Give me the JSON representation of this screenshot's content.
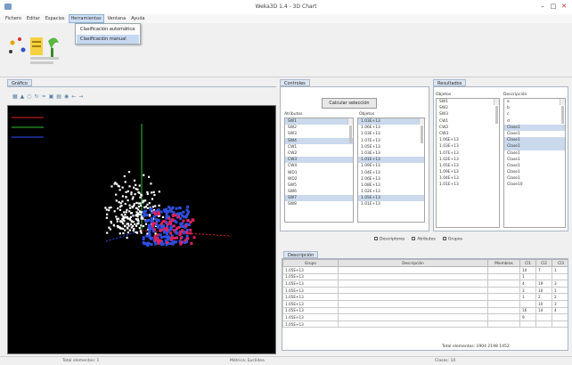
{
  "window": {
    "title": "Weka3D 1.4 - 3D Chart",
    "close_icon": "close-icon",
    "minimize_icon": "minimize-icon",
    "maximize_icon": "maximize-icon"
  },
  "menu": {
    "items": [
      "Fichero",
      "Editar",
      "Espacios",
      "Herramientas",
      "Ventana",
      "Ayuda"
    ],
    "open_index": 3,
    "dropdown": [
      "Clasificación automática",
      "Clasificación manual"
    ],
    "dropdown_selected": 1
  },
  "viewer": {
    "tab": "Gráfico",
    "toolbar_icons": [
      "select-icon",
      "pan-icon",
      "zoom-icon",
      "rotate-icon",
      "axis-icon",
      "view-icon",
      "grid-icon",
      "color-icon"
    ],
    "axis_colors": {
      "x": "#e02020",
      "y": "#2fbf2f",
      "z": "#3050ff"
    }
  },
  "controls": {
    "tab": "Controles",
    "button": "Calcular selección",
    "list1": {
      "header": "Atributos",
      "items": [
        "SW1",
        "SW2",
        "SW3",
        "SW4",
        "CW1",
        "CW2",
        "CW3",
        "CW4",
        "WD1",
        "WD2",
        "SW5",
        "SW6",
        "SW7",
        "SW8"
      ],
      "selected": [
        0,
        3,
        6,
        12
      ]
    },
    "list2": {
      "header": "Objetos",
      "items": [
        "1.03E+13",
        "1.06E+13",
        "1.03E+13",
        "1.07E+13",
        "1.05E+13",
        "1.03E+13",
        "1.01E+13",
        "1.09E+13",
        "1.04E+13",
        "1.06E+13",
        "1.08E+13",
        "1.02E+13",
        "1.05E+13",
        "1.01E+13"
      ],
      "selected": [
        0,
        6,
        12
      ]
    }
  },
  "results": {
    "tab": "Resultados",
    "list1": {
      "header": "Objetos",
      "items": [
        "SW1",
        "SW2",
        "SW3",
        "CW1",
        "CW2",
        "CW3",
        "1.06E+13",
        "1.03E+13",
        "1.07E+13",
        "1.02E+13",
        "1.05E+13",
        "1.09E+13",
        "1.04E+13",
        "1.01E+13"
      ],
      "selected": []
    },
    "list2": {
      "header": "Descripción",
      "items": [
        "a",
        "b",
        "c",
        "d",
        "Clase1",
        "Clase1",
        "Clase1",
        "Clase1",
        "Clase1",
        "Clase1",
        "Clase1",
        "Clase1",
        "Clase1",
        "Clase10"
      ],
      "selected": [
        4,
        6,
        7
      ]
    },
    "checkboxes": [
      "Descriptores",
      "Atributos",
      "Grupos"
    ]
  },
  "table_panel": {
    "tab": "Descripción",
    "headers": [
      "Grupo",
      "Descripción",
      "Miembros",
      "Cl1",
      "Cl2",
      "Cl3"
    ],
    "rows": [
      [
        "1.05E+13",
        "",
        "",
        "10",
        "7",
        "1"
      ],
      [
        "1.05E+13",
        "",
        "",
        "1",
        "",
        ""
      ],
      [
        "1.05E+13",
        "",
        "",
        "4",
        "19",
        "3"
      ],
      [
        "1.05E+13",
        "",
        "",
        "3",
        "10",
        "1"
      ],
      [
        "1.05E+13",
        "",
        "",
        "1",
        "2",
        "2"
      ],
      [
        "1.05E+13",
        "",
        "",
        "",
        "10",
        "3"
      ],
      [
        "1.05E+13",
        "",
        "",
        "16",
        "14",
        "4"
      ],
      [
        "1.05E+13",
        "",
        "",
        "9",
        "",
        ""
      ],
      [
        "1.05E+13",
        "",
        "",
        "",
        "",
        ""
      ]
    ],
    "total_label": "Total elementos: 1904  2198  1452"
  },
  "status": {
    "left": "Total elementos: 1",
    "center": "Métrica: Euclidea",
    "right": "Clases: 10"
  },
  "scatter_colors": {
    "white": "#ffffff",
    "blue": "#2f4fe0",
    "red": "#e0205a"
  }
}
